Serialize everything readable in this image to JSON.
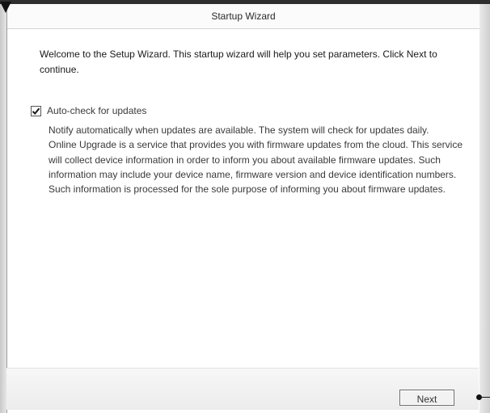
{
  "window": {
    "title": "Startup Wizard"
  },
  "intro": {
    "text": "Welcome to the Setup Wizard. This startup wizard will help you set parameters. Click Next to continue."
  },
  "auto_check": {
    "label": "Auto-check for updates",
    "checked": true
  },
  "description": {
    "notify": "Notify automatically when updates are available. The system will check for updates daily.",
    "online_upgrade": "Online Upgrade is a service that provides you with firmware updates from the cloud. This service will collect device information in order to inform you about available firmware updates. Such information may include your device name, firmware version and device identification numbers. Such information is processed for the sole purpose of informing you about firmware updates."
  },
  "footer": {
    "next_label": "Next"
  }
}
